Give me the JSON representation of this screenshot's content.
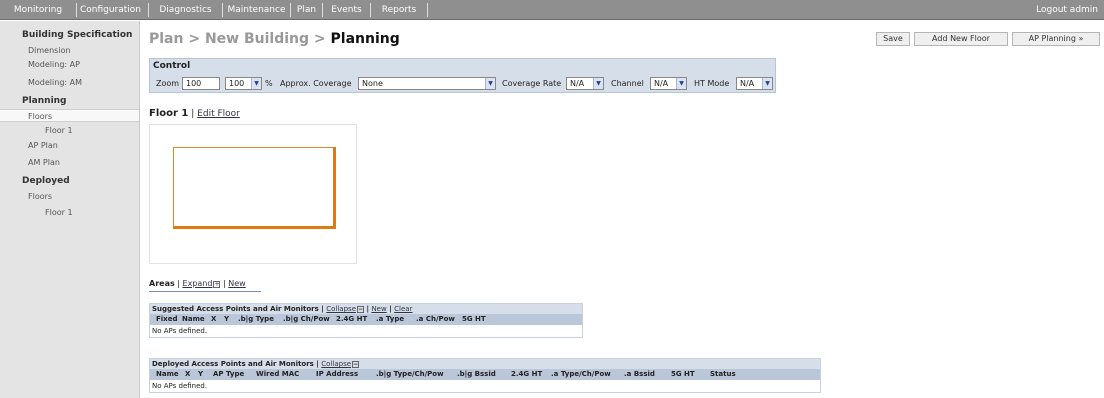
{
  "nav": {
    "items": [
      "Monitoring",
      "Configuration",
      "Diagnostics",
      "Maintenance",
      "Plan",
      "Events",
      "Reports"
    ],
    "logout": "Logout admin"
  },
  "sidebar": {
    "building_spec_heading": "Building Specification",
    "dimension": "Dimension",
    "modeling_ap": "Modeling: AP",
    "modeling_am": "Modeling: AM",
    "planning_heading": "Planning",
    "floors": "Floors",
    "floor1": "Floor 1",
    "ap_plan": "AP Plan",
    "am_plan": "AM Plan",
    "deployed_heading": "Deployed",
    "deployed_floors": "Floors",
    "deployed_floor1": "Floor 1"
  },
  "header": {
    "crumb1": "Plan",
    "crumb2": "New Building",
    "current": "Planning",
    "separator": " > "
  },
  "buttons": {
    "save": "Save",
    "add_floor": "Add New Floor",
    "ap_planning": "AP Planning »"
  },
  "control": {
    "title": "Control",
    "zoom_label": "Zoom",
    "zoom_value": "100",
    "zoom_select": "100",
    "percent": "%",
    "coverage_label": "Approx. Coverage",
    "coverage_value": "None",
    "rate_label": "Coverage Rate",
    "rate_value": "N/A",
    "channel_label": "Channel",
    "channel_value": "N/A",
    "ht_label": "HT Mode",
    "ht_value": "N/A"
  },
  "floor": {
    "title": "Floor 1",
    "sep": "|",
    "edit": "Edit Floor"
  },
  "areas": {
    "title": "Areas",
    "sep": "|",
    "expand": "Expand",
    "new": "New"
  },
  "suggested": {
    "title": "Suggested Access Points and Air Monitors",
    "collapse": "Collapse",
    "new": "New",
    "clear": "Clear",
    "sep": "|",
    "columns": [
      "Fixed",
      "Name",
      "X",
      "Y",
      ".b|g Type",
      ".b|g Ch/Pow",
      "2.4G HT",
      ".a Type",
      ".a Ch/Pow",
      "5G HT"
    ],
    "empty": "No APs defined."
  },
  "deployed": {
    "title": "Deployed Access Points and Air Monitors",
    "collapse": "Collapse",
    "sep": "|",
    "columns": [
      "Name",
      "X",
      "Y",
      "AP Type",
      "Wired MAC",
      "IP Address",
      ".b|g Type/Ch/Pow",
      ".b|g Bssid",
      "2.4G HT",
      ".a Type/Ch/Pow",
      ".a Bssid",
      "5G HT",
      "Status"
    ],
    "empty": "No APs defined."
  },
  "colors": {
    "nav_bg": "#8f8f8f",
    "sidebar_bg": "#e4e4e4",
    "panel_bg": "#d6dfe9",
    "table_head_bg": "#b9c7d8",
    "floor_outline": "#e07a10"
  }
}
